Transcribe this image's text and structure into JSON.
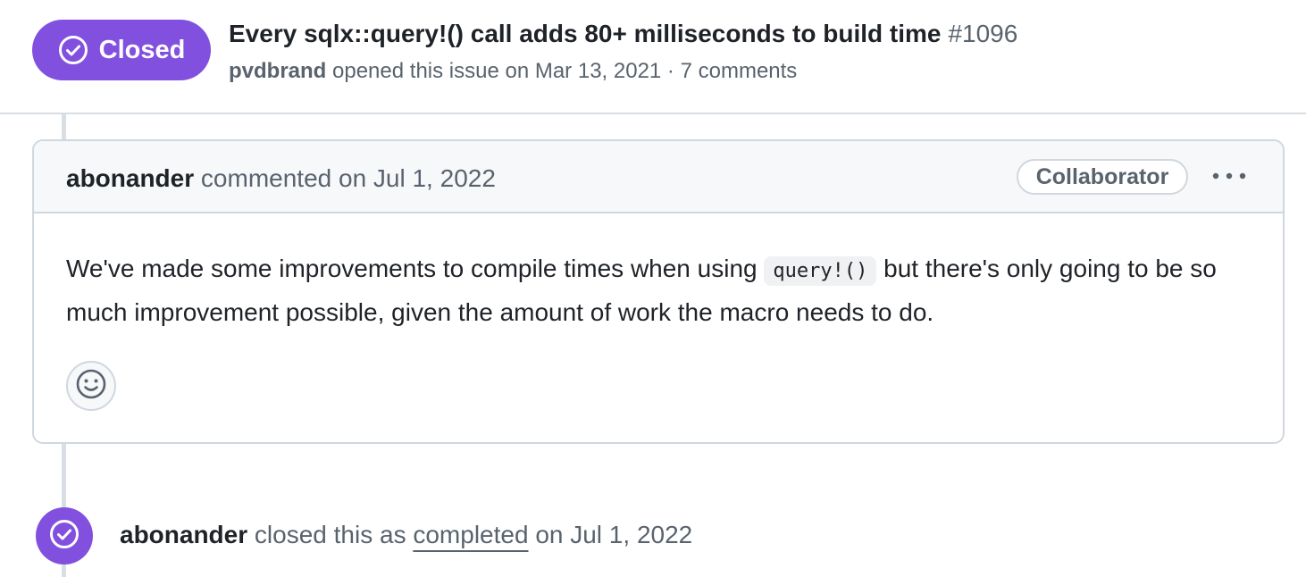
{
  "issue": {
    "state": "Closed",
    "title": "Every sqlx::query!() call adds 80+ milliseconds to build time",
    "number": "#1096",
    "author": "pvdbrand",
    "opened_text": "opened this issue on Mar 13, 2021 · 7 comments"
  },
  "comment": {
    "author": "abonander",
    "action_text": "commented on Jul 1, 2022",
    "role": "Collaborator",
    "body_before": "We've made some improvements to compile times when using",
    "body_code": "query!()",
    "body_after": "but there's only going to be so much improvement possible, given the amount of work the macro needs to do."
  },
  "event": {
    "author": "abonander",
    "text_before": "closed this as",
    "reason": "completed",
    "text_after": "on Jul 1, 2022"
  },
  "colors": {
    "closed_purple": "#8250df",
    "muted_text": "#59636e",
    "border": "#d0d7de"
  },
  "icons": [
    "check-circle-icon",
    "kebab-horizontal-icon",
    "smiley-icon"
  ]
}
